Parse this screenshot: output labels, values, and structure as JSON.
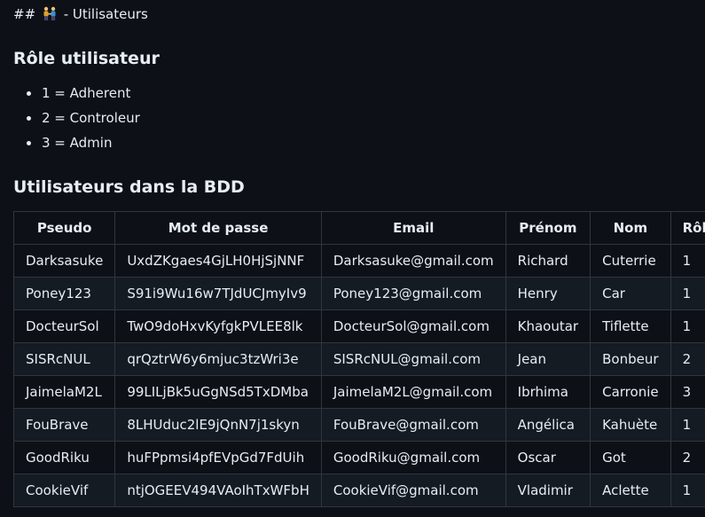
{
  "heading": {
    "prefix": "##",
    "emoji_icon": "people-holding-hands-icon",
    "text": "- Utilisateurs"
  },
  "roles": {
    "title": "Rôle utilisateur",
    "items": [
      "1 = Adherent",
      "2 = Controleur",
      "3 = Admin"
    ]
  },
  "users": {
    "title": "Utilisateurs dans la BDD",
    "columns": [
      "Pseudo",
      "Mot de passe",
      "Email",
      "Prénom",
      "Nom",
      "Rôle"
    ],
    "rows": [
      [
        "Darksasuke",
        "UxdZKgaes4GjLH0HjSjNNF",
        "Darksasuke@gmail.com",
        "Richard",
        "Cuterrie",
        "1"
      ],
      [
        "Poney123",
        "S91i9Wu16w7TJdUCJmyIv9",
        "Poney123@gmail.com",
        "Henry",
        "Car",
        "1"
      ],
      [
        "DocteurSol",
        "TwO9doHxvKyfgkPVLEE8lk",
        "DocteurSol@gmail.com",
        "Khaoutar",
        "Tiflette",
        "1"
      ],
      [
        "SISRcNUL",
        "qrQztrW6y6mjuc3tzWri3e",
        "SISRcNUL@gmail.com",
        "Jean",
        "Bonbeur",
        "2"
      ],
      [
        "JaimelaM2L",
        "99LILjBk5uGgNSd5TxDMba",
        "JaimelaM2L@gmail.com",
        "Ibrhima",
        "Carronie",
        "3"
      ],
      [
        "FouBrave",
        "8LHUduc2lE9jQnN7j1skyn",
        "FouBrave@gmail.com",
        "Angélica",
        "Kahuète",
        "1"
      ],
      [
        "GoodRiku",
        "huFPpmsi4pfEVpGd7FdUih",
        "GoodRiku@gmail.com",
        "Oscar",
        "Got",
        "2"
      ],
      [
        "CookieVif",
        "ntjOGEEV494VAoIhTxWFbH",
        "CookieVif@gmail.com",
        "Vladimir",
        "Aclette",
        "1"
      ]
    ]
  }
}
